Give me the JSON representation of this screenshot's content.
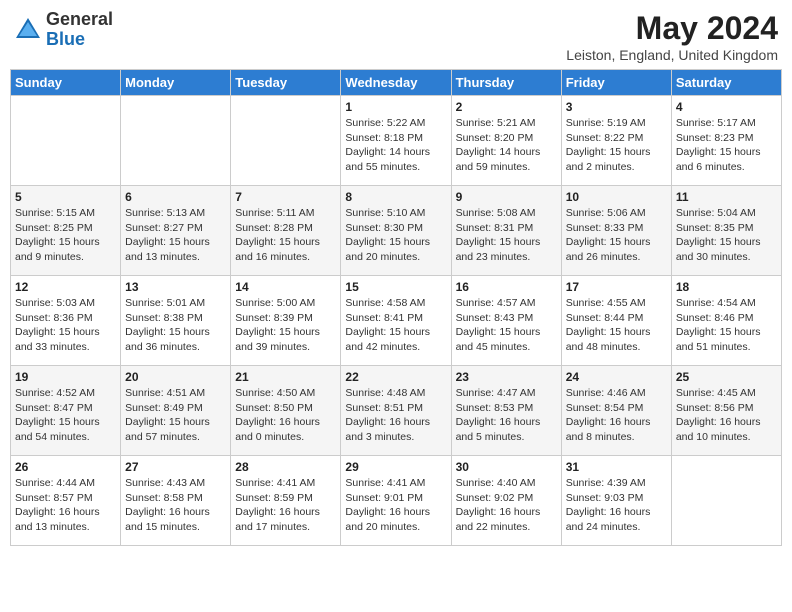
{
  "header": {
    "logo_general": "General",
    "logo_blue": "Blue",
    "month_title": "May 2024",
    "location": "Leiston, England, United Kingdom"
  },
  "weekdays": [
    "Sunday",
    "Monday",
    "Tuesday",
    "Wednesday",
    "Thursday",
    "Friday",
    "Saturday"
  ],
  "weeks": [
    [
      {
        "day": "",
        "info": ""
      },
      {
        "day": "",
        "info": ""
      },
      {
        "day": "",
        "info": ""
      },
      {
        "day": "1",
        "info": "Sunrise: 5:22 AM\nSunset: 8:18 PM\nDaylight: 14 hours and 55 minutes."
      },
      {
        "day": "2",
        "info": "Sunrise: 5:21 AM\nSunset: 8:20 PM\nDaylight: 14 hours and 59 minutes."
      },
      {
        "day": "3",
        "info": "Sunrise: 5:19 AM\nSunset: 8:22 PM\nDaylight: 15 hours and 2 minutes."
      },
      {
        "day": "4",
        "info": "Sunrise: 5:17 AM\nSunset: 8:23 PM\nDaylight: 15 hours and 6 minutes."
      }
    ],
    [
      {
        "day": "5",
        "info": "Sunrise: 5:15 AM\nSunset: 8:25 PM\nDaylight: 15 hours and 9 minutes."
      },
      {
        "day": "6",
        "info": "Sunrise: 5:13 AM\nSunset: 8:27 PM\nDaylight: 15 hours and 13 minutes."
      },
      {
        "day": "7",
        "info": "Sunrise: 5:11 AM\nSunset: 8:28 PM\nDaylight: 15 hours and 16 minutes."
      },
      {
        "day": "8",
        "info": "Sunrise: 5:10 AM\nSunset: 8:30 PM\nDaylight: 15 hours and 20 minutes."
      },
      {
        "day": "9",
        "info": "Sunrise: 5:08 AM\nSunset: 8:31 PM\nDaylight: 15 hours and 23 minutes."
      },
      {
        "day": "10",
        "info": "Sunrise: 5:06 AM\nSunset: 8:33 PM\nDaylight: 15 hours and 26 minutes."
      },
      {
        "day": "11",
        "info": "Sunrise: 5:04 AM\nSunset: 8:35 PM\nDaylight: 15 hours and 30 minutes."
      }
    ],
    [
      {
        "day": "12",
        "info": "Sunrise: 5:03 AM\nSunset: 8:36 PM\nDaylight: 15 hours and 33 minutes."
      },
      {
        "day": "13",
        "info": "Sunrise: 5:01 AM\nSunset: 8:38 PM\nDaylight: 15 hours and 36 minutes."
      },
      {
        "day": "14",
        "info": "Sunrise: 5:00 AM\nSunset: 8:39 PM\nDaylight: 15 hours and 39 minutes."
      },
      {
        "day": "15",
        "info": "Sunrise: 4:58 AM\nSunset: 8:41 PM\nDaylight: 15 hours and 42 minutes."
      },
      {
        "day": "16",
        "info": "Sunrise: 4:57 AM\nSunset: 8:43 PM\nDaylight: 15 hours and 45 minutes."
      },
      {
        "day": "17",
        "info": "Sunrise: 4:55 AM\nSunset: 8:44 PM\nDaylight: 15 hours and 48 minutes."
      },
      {
        "day": "18",
        "info": "Sunrise: 4:54 AM\nSunset: 8:46 PM\nDaylight: 15 hours and 51 minutes."
      }
    ],
    [
      {
        "day": "19",
        "info": "Sunrise: 4:52 AM\nSunset: 8:47 PM\nDaylight: 15 hours and 54 minutes."
      },
      {
        "day": "20",
        "info": "Sunrise: 4:51 AM\nSunset: 8:49 PM\nDaylight: 15 hours and 57 minutes."
      },
      {
        "day": "21",
        "info": "Sunrise: 4:50 AM\nSunset: 8:50 PM\nDaylight: 16 hours and 0 minutes."
      },
      {
        "day": "22",
        "info": "Sunrise: 4:48 AM\nSunset: 8:51 PM\nDaylight: 16 hours and 3 minutes."
      },
      {
        "day": "23",
        "info": "Sunrise: 4:47 AM\nSunset: 8:53 PM\nDaylight: 16 hours and 5 minutes."
      },
      {
        "day": "24",
        "info": "Sunrise: 4:46 AM\nSunset: 8:54 PM\nDaylight: 16 hours and 8 minutes."
      },
      {
        "day": "25",
        "info": "Sunrise: 4:45 AM\nSunset: 8:56 PM\nDaylight: 16 hours and 10 minutes."
      }
    ],
    [
      {
        "day": "26",
        "info": "Sunrise: 4:44 AM\nSunset: 8:57 PM\nDaylight: 16 hours and 13 minutes."
      },
      {
        "day": "27",
        "info": "Sunrise: 4:43 AM\nSunset: 8:58 PM\nDaylight: 16 hours and 15 minutes."
      },
      {
        "day": "28",
        "info": "Sunrise: 4:41 AM\nSunset: 8:59 PM\nDaylight: 16 hours and 17 minutes."
      },
      {
        "day": "29",
        "info": "Sunrise: 4:41 AM\nSunset: 9:01 PM\nDaylight: 16 hours and 20 minutes."
      },
      {
        "day": "30",
        "info": "Sunrise: 4:40 AM\nSunset: 9:02 PM\nDaylight: 16 hours and 22 minutes."
      },
      {
        "day": "31",
        "info": "Sunrise: 4:39 AM\nSunset: 9:03 PM\nDaylight: 16 hours and 24 minutes."
      },
      {
        "day": "",
        "info": ""
      }
    ]
  ]
}
